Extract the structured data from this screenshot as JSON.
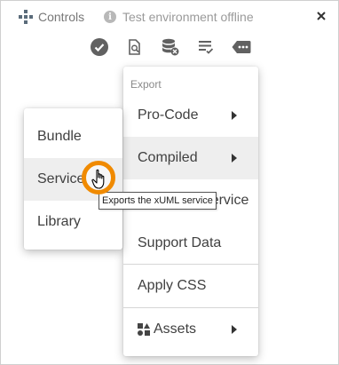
{
  "titlebar": {
    "controls_label": "Controls",
    "offline_label": "Test environment offline",
    "info_glyph": "i"
  },
  "toolbar": {
    "icons": [
      "check-circle-icon",
      "search-document-icon",
      "database-delete-icon",
      "list-check-icon",
      "tag-more-icon"
    ]
  },
  "main_menu": {
    "header": "Export",
    "items": [
      {
        "label": "Pro-Code",
        "has_submenu": true
      },
      {
        "label": "Compiled",
        "has_submenu": true,
        "highlighted": true
      },
      {
        "label": "Compiled Service",
        "has_submenu": false
      },
      {
        "label": "Support Data",
        "has_submenu": false
      },
      {
        "label": "Apply CSS",
        "has_submenu": false
      },
      {
        "label": "Assets",
        "has_submenu": true,
        "icon": "assets-icon"
      }
    ]
  },
  "sub_menu": {
    "items": [
      {
        "label": "Bundle"
      },
      {
        "label": "Service",
        "hovered": true
      },
      {
        "label": "Library"
      }
    ]
  },
  "tooltip": {
    "text": "Exports the xUML service"
  },
  "colors": {
    "highlight": "#eeeeee",
    "cursor_ring": "#f08a00",
    "toolbar_icon": "#616161"
  }
}
